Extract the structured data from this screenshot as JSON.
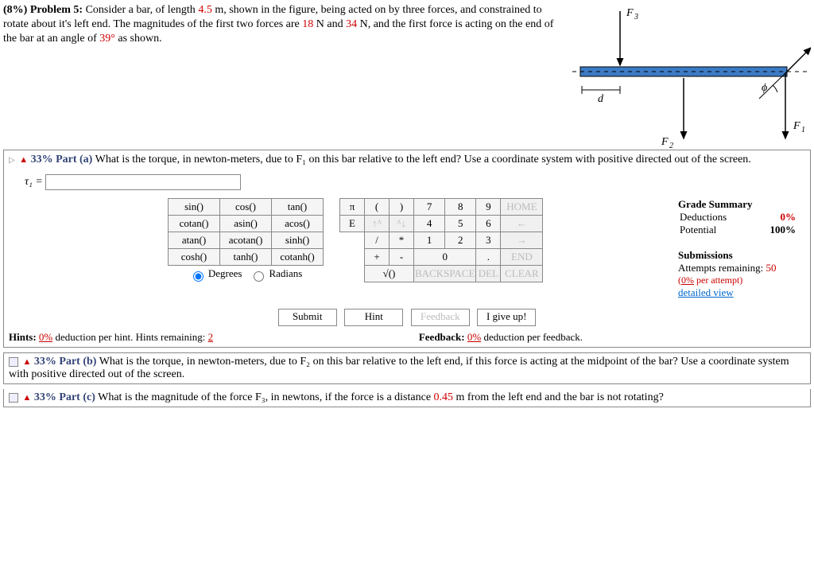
{
  "problem": {
    "header_pct": "(8%)",
    "header_label": "Problem 5:",
    "text1": "Consider a bar, of length ",
    "length": "4.5",
    "text2": " m, shown in the figure, being acted on by three forces, and constrained to rotate about it's left end. The magnitudes of the first two forces are ",
    "f1": "18",
    "text3": " N and ",
    "f2": "34",
    "text4": " N, and the first force is acting on the end of the bar at an angle of ",
    "angle": "39°",
    "text5": " as shown."
  },
  "figure": {
    "F3": "F",
    "F3sub": "3",
    "F2": "F",
    "F2sub": "2",
    "F1": "F",
    "F1sub": "1",
    "d": "d",
    "phi": "ϕ"
  },
  "part_a": {
    "caret": "▷",
    "warn": "▲",
    "pct": "33%",
    "label": "Part (a)",
    "question": "What is the torque, in newton-meters, due to F₁ on this bar relative to the left end? Use a coordinate system with positive directed out of the screen.",
    "var": "τ₁ = "
  },
  "funcs": [
    [
      "sin()",
      "cos()",
      "tan()"
    ],
    [
      "cotan()",
      "asin()",
      "acos()"
    ],
    [
      "atan()",
      "acotan()",
      "sinh()"
    ],
    [
      "cosh()",
      "tanh()",
      "cotanh()"
    ]
  ],
  "angle_mode": {
    "deg": "Degrees",
    "rad": "Radians"
  },
  "numpad": {
    "r1": [
      "π",
      "(",
      ")",
      "7",
      "8",
      "9",
      "HOME"
    ],
    "r2": [
      "E",
      "↑ᴬ",
      "ᴬ↓",
      "4",
      "5",
      "6",
      "←"
    ],
    "r3": [
      "",
      "/",
      "*",
      "1",
      "2",
      "3",
      "→"
    ],
    "r4": [
      "",
      "+",
      "-",
      "0",
      ".",
      "END"
    ],
    "r5": [
      "√()",
      "BACKSPACE",
      "DEL",
      "CLEAR"
    ]
  },
  "grade": {
    "title": "Grade Summary",
    "ded_l": "Deductions",
    "ded_v": "0%",
    "pot_l": "Potential",
    "pot_v": "100%",
    "sub_t": "Submissions",
    "att_l": "Attempts remaining: ",
    "att_v": "50",
    "per": "(0% per attempt)",
    "det": "detailed view"
  },
  "actions": {
    "submit": "Submit",
    "hint": "Hint",
    "feedback": "Feedback",
    "giveup": "I give up!"
  },
  "hints": {
    "pre": "Hints: ",
    "pct": "0%",
    "mid": " deduction per hint. Hints remaining: ",
    "rem": "2",
    "fpre": "Feedback: ",
    "fpct": "0%",
    "fpost": " deduction per feedback."
  },
  "part_b": {
    "pct": "33%",
    "label": "Part (b)",
    "q": "What is the torque, in newton-meters, due to F₂ on this bar relative to the left end, if this force is acting at the midpoint of the bar? Use a coordinate system with positive directed out of the screen."
  },
  "part_c": {
    "pct": "33%",
    "label": "Part (c)",
    "q1": "What is the magnitude of the force F₃, in newtons, if the force is a distance ",
    "d": "0.45",
    "q2": " m from the left end and the bar is not rotating?"
  }
}
